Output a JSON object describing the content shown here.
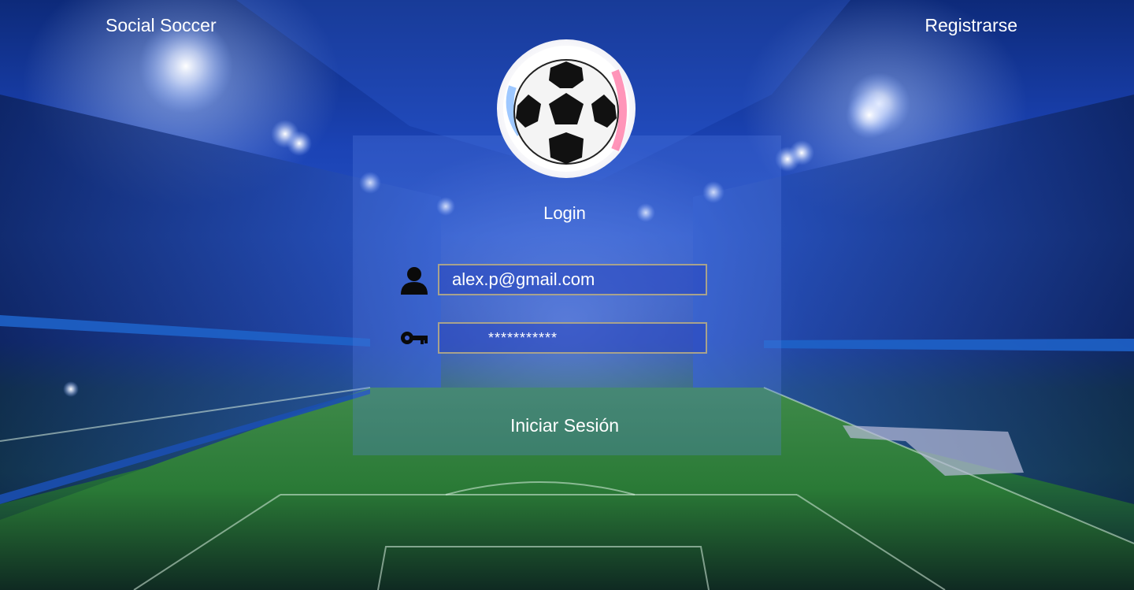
{
  "header": {
    "brand": "Social Soccer",
    "register_label": "Registrarse"
  },
  "login": {
    "title": "Login",
    "email_value": "alex.p@gmail.com",
    "password_value": "***********",
    "submit_label": "Iniciar Sesión"
  },
  "icons": {
    "user": "user-icon",
    "key": "key-icon",
    "logo": "soccer-ball-icon"
  },
  "colors": {
    "field_border": "#a8a28c",
    "text": "#ffffff"
  }
}
